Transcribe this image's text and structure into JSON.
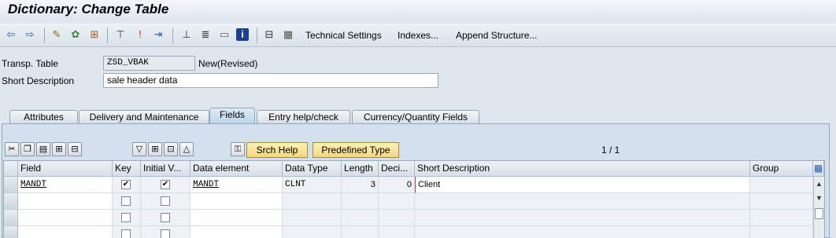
{
  "title": "Dictionary: Change Table",
  "toolbar": {
    "technical_settings": "Technical Settings",
    "indexes": "Indexes...",
    "append_structure": "Append Structure..."
  },
  "header": {
    "transp_table_label": "Transp. Table",
    "transp_table_value": "ZSD_VBAK",
    "status": "New(Revised)",
    "short_desc_label": "Short Description",
    "short_desc_value": "sale header data"
  },
  "tabs": [
    {
      "label": "Attributes"
    },
    {
      "label": "Delivery and Maintenance"
    },
    {
      "label": "Fields"
    },
    {
      "label": "Entry help/check"
    },
    {
      "label": "Currency/Quantity Fields"
    }
  ],
  "active_tab": "Fields",
  "fields_toolbar": {
    "srch_help": "Srch Help",
    "predefined_type": "Predefined Type",
    "pager": "1 / 1"
  },
  "grid": {
    "columns": [
      "Field",
      "Key",
      "Initial V...",
      "Data element",
      "Data Type",
      "Length",
      "Deci...",
      "Short Description",
      "Group"
    ],
    "rows": [
      {
        "field": "MANDT",
        "key": true,
        "initial": true,
        "data_element": "MANDT",
        "data_type": "CLNT",
        "length": "3",
        "decimals": "0",
        "short_desc": "Client",
        "group": ""
      },
      {
        "field": "",
        "key": false,
        "initial": false,
        "data_element": "",
        "data_type": "",
        "length": "",
        "decimals": "",
        "short_desc": "",
        "group": ""
      },
      {
        "field": "",
        "key": false,
        "initial": false,
        "data_element": "",
        "data_type": "",
        "length": "",
        "decimals": "",
        "short_desc": "",
        "group": ""
      },
      {
        "field": "",
        "key": false,
        "initial": false,
        "data_element": "",
        "data_type": "",
        "length": "",
        "decimals": "",
        "short_desc": "",
        "group": ""
      }
    ]
  },
  "colors": {
    "accent": "#f2d97a",
    "panel": "#d3e0ee",
    "background": "#dfe6ee"
  }
}
